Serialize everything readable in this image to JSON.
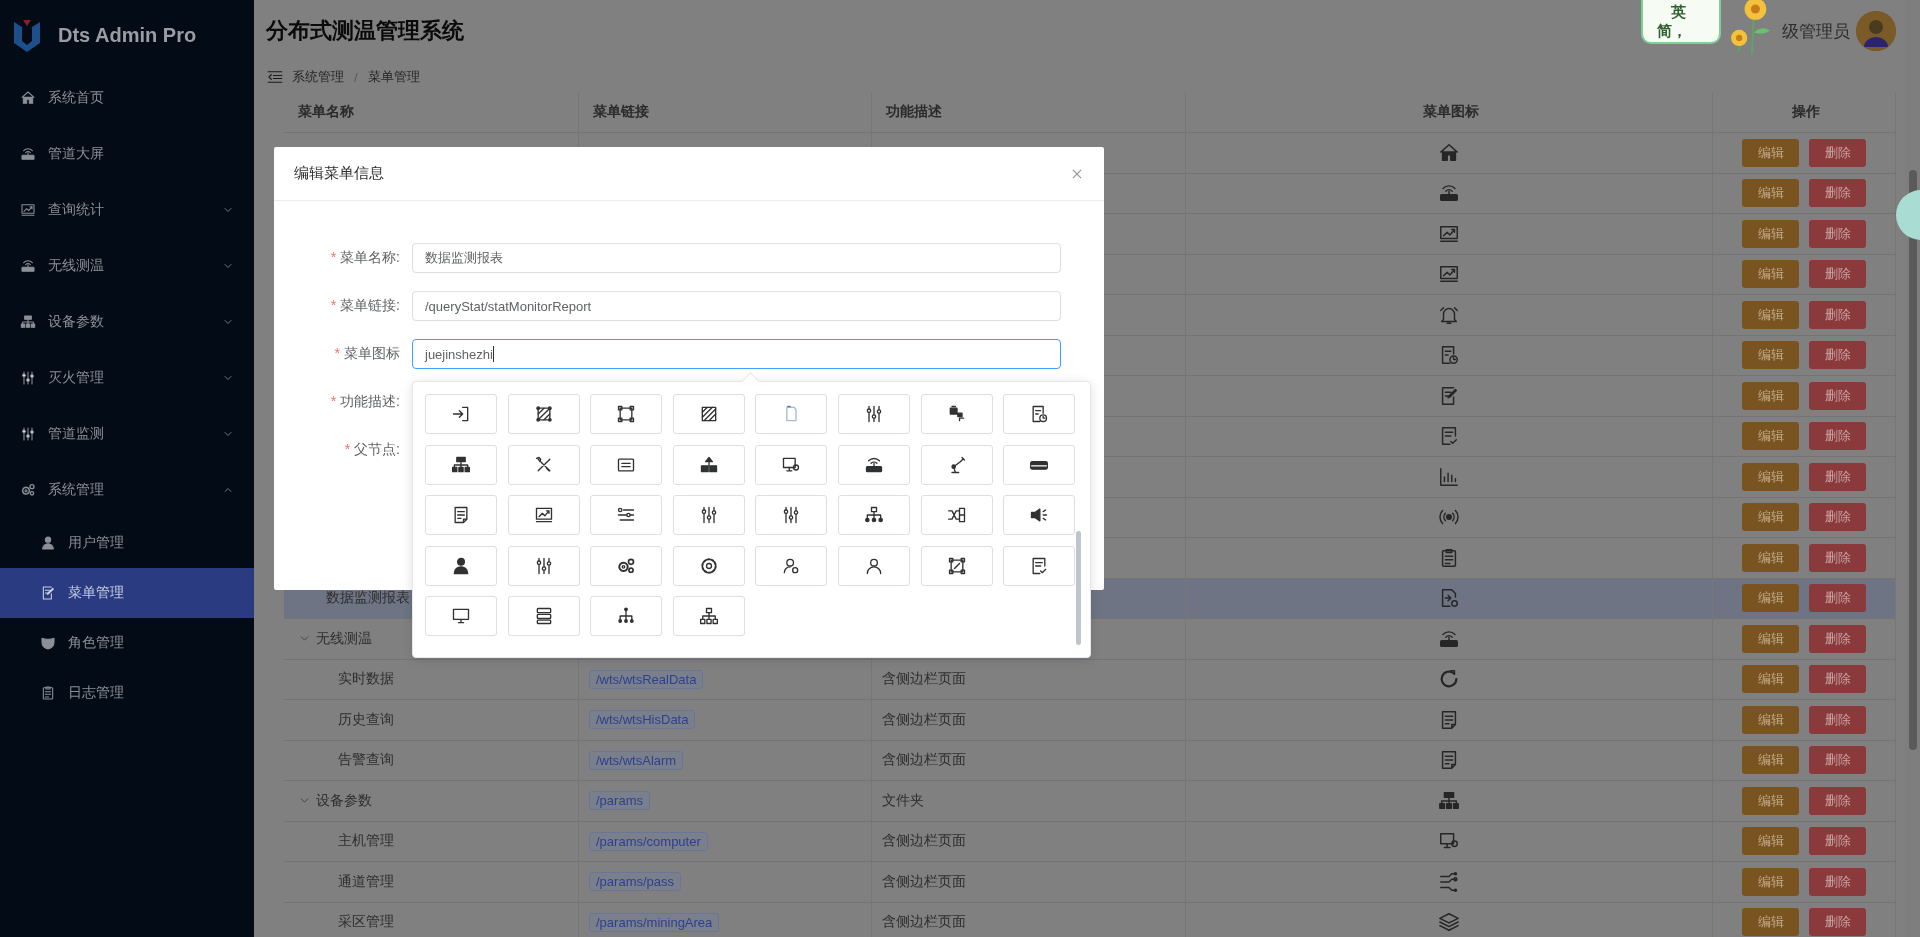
{
  "sidebar": {
    "logo": "Dts Admin Pro",
    "items": [
      {
        "label": "系统首页",
        "kind": "link",
        "selected": false
      },
      {
        "label": "管道大屏",
        "kind": "link",
        "selected": false
      },
      {
        "label": "查询统计",
        "kind": "submenu",
        "expanded": false
      },
      {
        "label": "无线测温",
        "kind": "submenu",
        "expanded": false
      },
      {
        "label": "设备参数",
        "kind": "submenu",
        "expanded": false
      },
      {
        "label": "灭火管理",
        "kind": "submenu",
        "expanded": false
      },
      {
        "label": "管道监测",
        "kind": "submenu",
        "expanded": false
      },
      {
        "label": "系统管理",
        "kind": "submenu",
        "expanded": true,
        "children": [
          {
            "label": "用户管理",
            "selected": false
          },
          {
            "label": "菜单管理",
            "selected": true
          },
          {
            "label": "角色管理",
            "selected": false
          },
          {
            "label": "日志管理",
            "selected": false
          }
        ]
      }
    ]
  },
  "header": {
    "title": "分布式测温管理系统",
    "user": "级管理员",
    "sticker": [
      "英",
      "简，"
    ]
  },
  "breadcrumb": {
    "items": [
      "系统管理",
      "菜单管理"
    ],
    "separator": "/"
  },
  "table": {
    "columns": [
      "菜单名称",
      "菜单链接",
      "功能描述",
      "菜单图标",
      "操作"
    ],
    "rows": [
      {
        "kind": "leaf",
        "selected": false,
        "actions": [
          "编辑",
          "删除"
        ]
      },
      {
        "kind": "leaf",
        "selected": false,
        "actions": [
          "编辑",
          "删除"
        ]
      },
      {
        "kind": "leaf",
        "selected": false,
        "actions": [
          "编辑",
          "删除"
        ]
      },
      {
        "kind": "leaf",
        "selected": false,
        "actions": [
          "编辑",
          "删除"
        ]
      },
      {
        "kind": "leaf",
        "selected": false,
        "actions": [
          "编辑",
          "删除"
        ]
      },
      {
        "kind": "leaf",
        "selected": false,
        "actions": [
          "编辑",
          "删除"
        ]
      },
      {
        "kind": "leaf",
        "selected": false,
        "actions": [
          "编辑",
          "删除"
        ]
      },
      {
        "kind": "leaf",
        "selected": false,
        "actions": [
          "编辑",
          "删除"
        ]
      },
      {
        "kind": "leaf",
        "selected": false,
        "actions": [
          "编辑",
          "删除"
        ]
      },
      {
        "kind": "leaf",
        "selected": false,
        "actions": [
          "编辑",
          "删除"
        ]
      },
      {
        "kind": "leaf",
        "selected": false,
        "actions": [
          "编辑",
          "删除"
        ]
      },
      {
        "kind": "leaf",
        "name": "数据监测报表",
        "selected": true,
        "actions": [
          "编辑",
          "删除"
        ]
      },
      {
        "kind": "group",
        "name": "无线测温",
        "expanded": true,
        "selected": false,
        "actions": [
          "编辑",
          "删除"
        ],
        "children": [
          {
            "kind": "leaf",
            "name": "实时数据",
            "link": "/wts/wtsRealData",
            "description": "含侧边栏页面",
            "selected": false,
            "actions": [
              "编辑",
              "删除"
            ]
          },
          {
            "kind": "leaf",
            "name": "历史查询",
            "link": "/wts/wtsHisData",
            "description": "含侧边栏页面",
            "selected": false,
            "actions": [
              "编辑",
              "删除"
            ]
          },
          {
            "kind": "leaf",
            "name": "告警查询",
            "link": "/wts/wtsAlarm",
            "description": "含侧边栏页面",
            "selected": false,
            "actions": [
              "编辑",
              "删除"
            ]
          }
        ]
      },
      {
        "kind": "group",
        "name": "设备参数",
        "link": "/params",
        "description": "文件夹",
        "expanded": true,
        "selected": false,
        "actions": [
          "编辑",
          "删除"
        ],
        "children": [
          {
            "kind": "leaf",
            "name": "主机管理",
            "link": "/params/computer",
            "description": "含侧边栏页面",
            "selected": false,
            "actions": [
              "编辑",
              "删除"
            ]
          },
          {
            "kind": "leaf",
            "name": "通道管理",
            "link": "/params/pass",
            "description": "含侧边栏页面",
            "selected": false,
            "actions": [
              "编辑",
              "删除"
            ]
          },
          {
            "kind": "leaf",
            "name": "采区管理",
            "link": "/params/miningArea",
            "description": "含侧边栏页面",
            "selected": false,
            "actions": [
              "编辑",
              "删除"
            ]
          }
        ]
      }
    ]
  },
  "dialog": {
    "title": "编辑菜单信息",
    "fields": [
      {
        "mark": "*",
        "label": "菜单名称:",
        "value": "数据监测报表",
        "focused": false
      },
      {
        "mark": "*",
        "label": "菜单链接:",
        "value": "/queryStat/statMonitorReport",
        "focused": false
      },
      {
        "mark": "*",
        "label": "菜单图标",
        "value": "juejinshezhi",
        "focused": true
      },
      {
        "mark": "*",
        "label": "功能描述:"
      },
      {
        "mark": "*",
        "label": "父节点:"
      }
    ]
  },
  "icon_picker": {
    "open": true
  }
}
